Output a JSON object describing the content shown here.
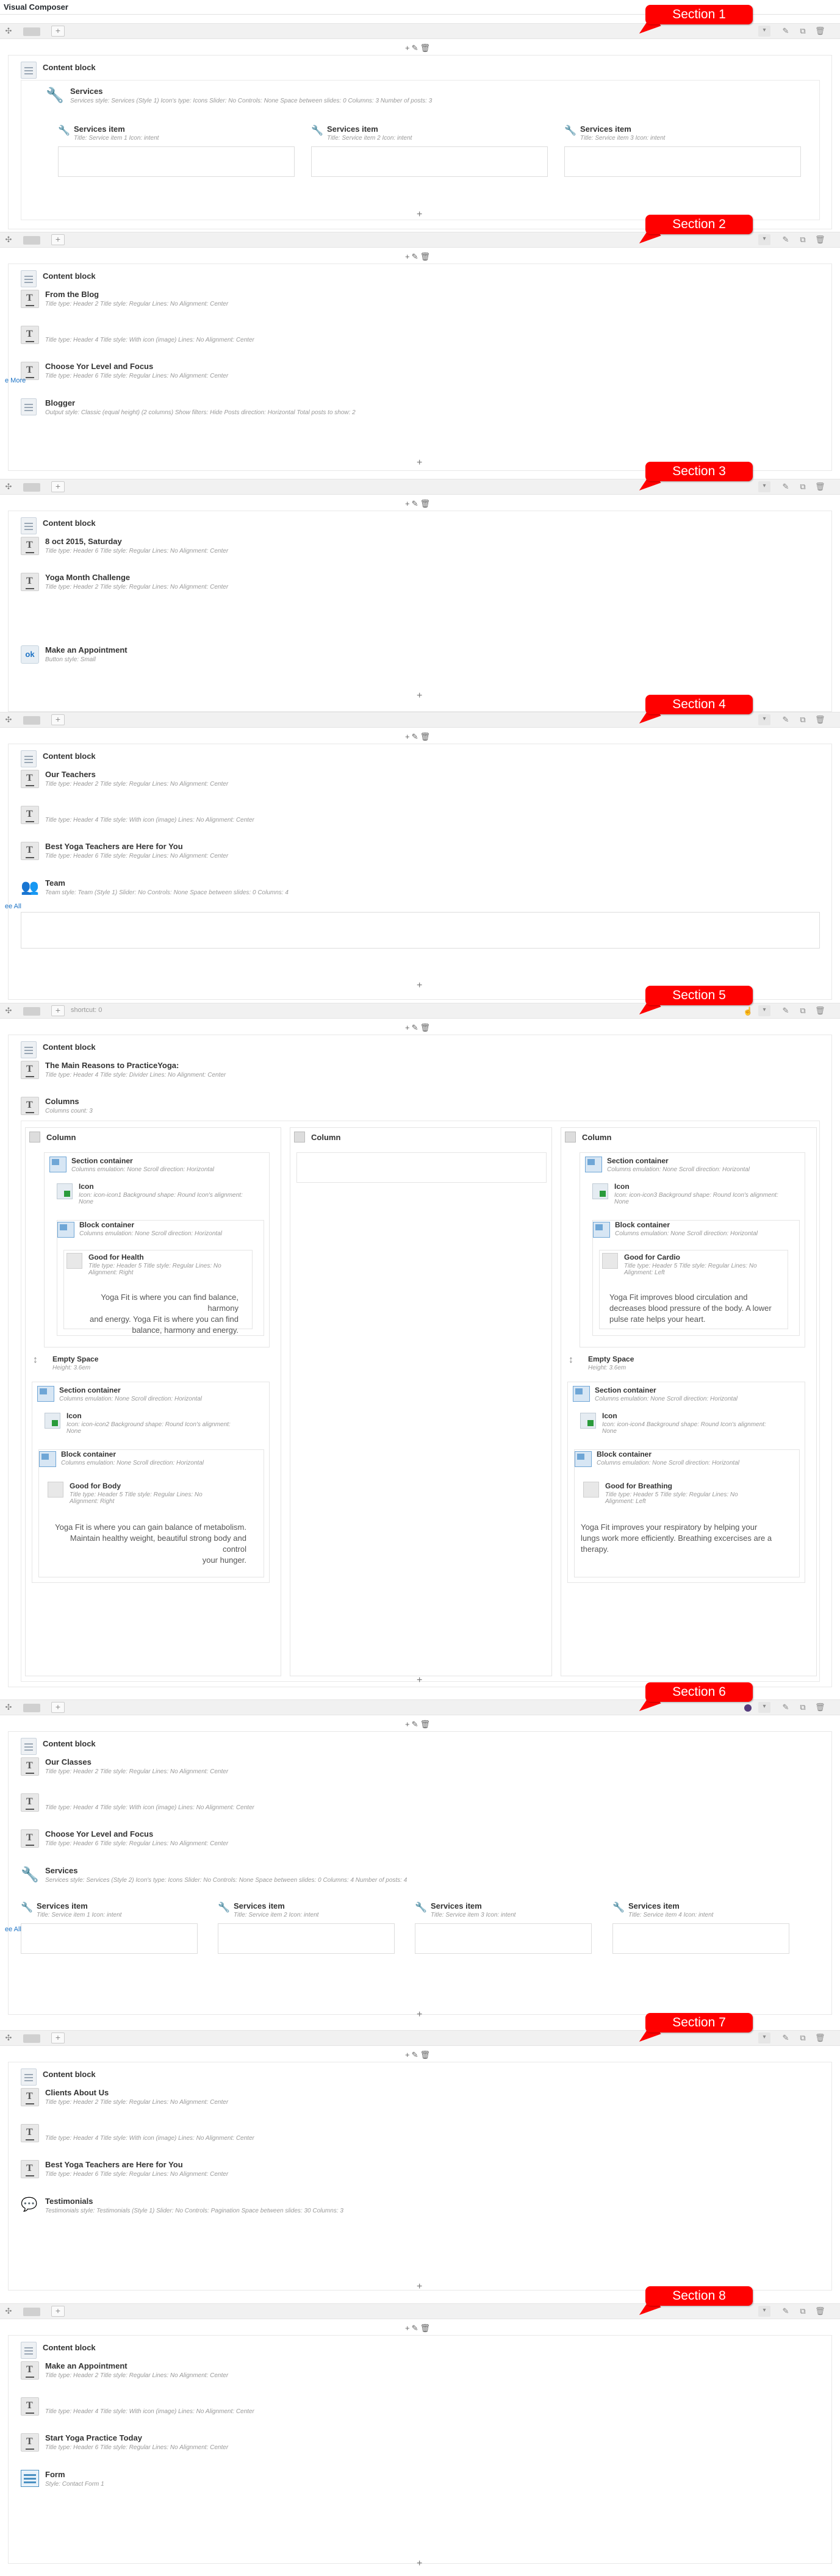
{
  "app": {
    "title": "Visual Composer"
  },
  "toolbar": {
    "add": "+",
    "edit": "✎",
    "del": "🗑",
    "bottom_plus": "+"
  },
  "labels": {
    "content_block": "Content block",
    "column": "Column",
    "more": "e More",
    "more2": "ee All",
    "more3": "ee All",
    "shortcut": "shortcut: 0"
  },
  "sections": [
    {
      "badge": "Section 1"
    },
    {
      "badge": "Section 2"
    },
    {
      "badge": "Section 3"
    },
    {
      "badge": "Section 4"
    },
    {
      "badge": "Section 5"
    },
    {
      "badge": "Section 6"
    },
    {
      "badge": "Section 7"
    },
    {
      "badge": "Section 8"
    }
  ],
  "s1": {
    "services": {
      "name": "Services",
      "params": "Services style: Services (Style 1)  Icon's type: Icons  Slider: No  Controls: None  Space between slides: 0  Columns: 3  Number of posts: 3"
    },
    "items": [
      {
        "name": "Services item",
        "params": "Title: Service item 1  Icon: intent"
      },
      {
        "name": "Services item",
        "params": "Title: Service item 2  Icon: intent"
      },
      {
        "name": "Services item",
        "params": "Title: Service item 3  Icon: intent"
      }
    ]
  },
  "s2": {
    "els": [
      {
        "name": "From the Blog",
        "params": "Title type: Header 2  Title style: Regular  Lines: No  Alignment: Center"
      },
      {
        "name": "",
        "params": "Title type: Header 4  Title style: With icon (image)  Lines: No  Alignment: Center"
      },
      {
        "name": "Choose Yor Level and Focus",
        "params": "Title type: Header 6  Title style: Regular  Lines: No  Alignment: Center"
      },
      {
        "name": "Blogger",
        "params": "Output style: Classic (equal height) (2 columns)  Show filters: Hide  Posts direction: Horizontal  Total posts to show: 2"
      }
    ]
  },
  "s3": {
    "els": [
      {
        "name": "8 oct 2015, Saturday",
        "params": "Title type: Header 6  Title style: Regular  Lines: No  Alignment: Center"
      },
      {
        "name": "Yoga Month Challenge",
        "params": "Title type: Header 2  Title style: Regular  Lines: No  Alignment: Center"
      },
      {
        "name": "Make an Appointment",
        "params": "Button style: Small"
      }
    ],
    "ok": "ok"
  },
  "s4": {
    "els": [
      {
        "name": "Our Teachers",
        "params": "Title type: Header 2  Title style: Regular  Lines: No  Alignment: Center"
      },
      {
        "name": "",
        "params": "Title type: Header 4  Title style: With icon (image)  Lines: No  Alignment: Center"
      },
      {
        "name": "Best Yoga Teachers are Here for You",
        "params": "Title type: Header 6  Title style: Regular  Lines: No  Alignment: Center"
      },
      {
        "name": "Team",
        "params": "Team style: Team (Style 1)  Slider: No  Controls: None  Space between slides: 0  Columns: 4"
      }
    ]
  },
  "s5": {
    "title_el": {
      "name": "The Main Reasons to PracticeYoga:",
      "params": "Title type: Header 4  Title style: Divider  Lines: No  Alignment: Center"
    },
    "columns": {
      "name": "Columns",
      "params": "Columns count: 3"
    },
    "left": {
      "section1": {
        "name": "Section container",
        "params": "Columns emulation: None  Scroll direction: Horizontal"
      },
      "icon1": {
        "name": "Icon",
        "params": "Icon: icon-icon1  Background shape: Round  Icon's alignment: None"
      },
      "block1": {
        "name": "Block container",
        "params": "Columns emulation: None  Scroll direction: Horizontal"
      },
      "title1": {
        "name": "Good for Health",
        "params": "Title type: Header 5  Title style: Regular  Lines: No  Alignment: Right"
      },
      "text1": [
        "Yoga Fit is where you can find balance, harmony",
        "and energy. Yoga Fit is where you can find",
        "balance, harmony and energy."
      ],
      "space": {
        "name": "Empty Space",
        "params": "Height: 3.6em"
      },
      "section2": {
        "name": "Section container",
        "params": "Columns emulation: None  Scroll direction: Horizontal"
      },
      "icon2": {
        "name": "Icon",
        "params": "Icon: icon-icon2  Background shape: Round  Icon's alignment: None"
      },
      "block2": {
        "name": "Block container",
        "params": "Columns emulation: None  Scroll direction: Horizontal"
      },
      "title2": {
        "name": "Good for Body",
        "params": "Title type: Header 5  Title style: Regular  Lines: No  Alignment: Right"
      },
      "text2": [
        "Yoga Fit is where you can gain balance of metabolism.",
        "Maintain healthy weight, beautiful strong body and",
        "control",
        "your hunger."
      ]
    },
    "right": {
      "section1": {
        "name": "Section container",
        "params": "Columns emulation: None  Scroll direction: Horizontal"
      },
      "icon1": {
        "name": "Icon",
        "params": "Icon: icon-icon3  Background shape: Round  Icon's alignment: None"
      },
      "block1": {
        "name": "Block container",
        "params": "Columns emulation: None  Scroll direction: Horizontal"
      },
      "title1": {
        "name": "Good for Cardio",
        "params": "Title type: Header 5  Title style: Regular  Lines: No  Alignment: Left"
      },
      "text1": [
        "Yoga Fit improves blood circulation and",
        "decreases blood pressure of the body. A lower",
        "pulse rate helps your heart."
      ],
      "space": {
        "name": "Empty Space",
        "params": "Height: 3.6em"
      },
      "section2": {
        "name": "Section container",
        "params": "Columns emulation: None  Scroll direction: Horizontal"
      },
      "icon2": {
        "name": "Icon",
        "params": "Icon: icon-icon4  Background shape: Round  Icon's alignment: None"
      },
      "block2": {
        "name": "Block container",
        "params": "Columns emulation: None  Scroll direction: Horizontal"
      },
      "title2": {
        "name": "Good for Breathing",
        "params": "Title type: Header 5  Title style: Regular  Lines: No  Alignment: Left"
      },
      "text2": [
        "Yoga Fit improves your respiratory by helping your",
        "lungs work more efficiently. Breathing excercises are a",
        "therapy."
      ]
    }
  },
  "s6": {
    "els": [
      {
        "name": "Our Classes",
        "params": "Title type: Header 2  Title style: Regular  Lines: No  Alignment: Center"
      },
      {
        "name": "",
        "params": "Title type: Header 4  Title style: With icon (image)  Lines: No  Alignment: Center"
      },
      {
        "name": "Choose Yor Level and Focus",
        "params": "Title type: Header 6  Title style: Regular  Lines: No  Alignment: Center"
      },
      {
        "name": "Services",
        "params": "Services style: Services (Style 2)  Icon's type: Icons  Slider: No  Controls: None  Space between slides: 0  Columns: 4  Number of posts: 4"
      }
    ],
    "items": [
      {
        "name": "Services item",
        "params": "Title: Service item 1  Icon: intent"
      },
      {
        "name": "Services item",
        "params": "Title: Service item 2  Icon: intent"
      },
      {
        "name": "Services item",
        "params": "Title: Service item 3  Icon: intent"
      },
      {
        "name": "Services item",
        "params": "Title: Service item 4  Icon: intent"
      }
    ]
  },
  "s7": {
    "els": [
      {
        "name": "Clients About Us",
        "params": "Title type: Header 2  Title style: Regular  Lines: No  Alignment: Center"
      },
      {
        "name": "",
        "params": "Title type: Header 4  Title style: With icon (image)  Lines: No  Alignment: Center"
      },
      {
        "name": "Best Yoga Teachers are Here for You",
        "params": "Title type: Header 6  Title style: Regular  Lines: No  Alignment: Center"
      },
      {
        "name": "Testimonials",
        "params": "Testimonials style: Testimonials (Style 1)  Slider: No  Controls: Pagination  Space between slides: 30  Columns: 3"
      }
    ]
  },
  "s8": {
    "els": [
      {
        "name": "Make an Appointment",
        "params": "Title type: Header 2  Title style: Regular  Lines: No  Alignment: Center"
      },
      {
        "name": "",
        "params": "Title type: Header 4  Title style: With icon (image)  Lines: No  Alignment: Center"
      },
      {
        "name": "Start Yoga Practice Today",
        "params": "Title type: Header 6  Title style: Regular  Lines: No  Alignment: Center"
      },
      {
        "name": "Form",
        "params": "Style: Contact Form 1"
      }
    ]
  },
  "colors": {
    "badge": "#ff0000",
    "link": "#1d73c5",
    "bar": "#f1f1f1"
  }
}
